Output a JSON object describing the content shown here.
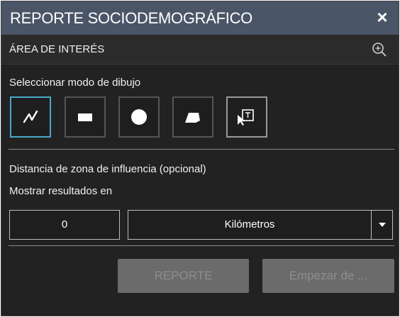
{
  "titlebar": {
    "title": "REPORTE SOCIODEMOGRÁFICO",
    "close_label": "×"
  },
  "subheader": {
    "label": "ÁREA DE INTERÉS",
    "icon": "zoom-in-icon"
  },
  "draw_mode": {
    "label": "Seleccionar modo de dibujo",
    "tools": [
      {
        "name": "polyline",
        "icon": "polyline-icon",
        "selected": true
      },
      {
        "name": "rectangle",
        "icon": "rectangle-icon",
        "selected": false
      },
      {
        "name": "circle",
        "icon": "circle-icon",
        "selected": false
      },
      {
        "name": "polygon",
        "icon": "polygon-icon",
        "selected": false
      },
      {
        "name": "select-feature",
        "icon": "select-feature-icon",
        "selected": false
      }
    ]
  },
  "buffer": {
    "label": "Distancia de zona de influencia (opcional)",
    "results_label": "Mostrar resultados en",
    "distance_value": "0",
    "unit_selected": "Kilómetros"
  },
  "actions": {
    "report_label": "REPORTE",
    "start_label": "Empezar de ..."
  },
  "colors": {
    "panel_bg": "#222222",
    "titlebar_bg": "#4a5568",
    "selected_border": "#4aa7c9",
    "disabled_button_bg": "#6b6b6b"
  }
}
